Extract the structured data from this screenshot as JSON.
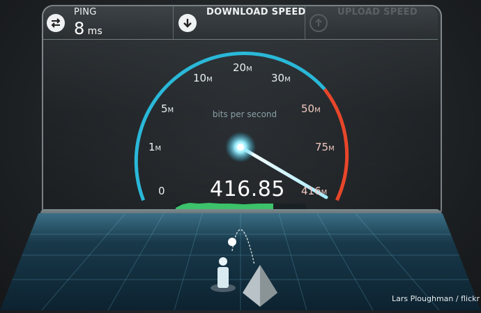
{
  "header": {
    "ping_label": "PING",
    "ping_value": "8",
    "ping_unit": "ms",
    "download_label": "DOWNLOAD SPEED",
    "upload_label": "UPLOAD SPEED"
  },
  "gauge": {
    "unit_caption": "bits per second",
    "speed_value": "416.85",
    "ticks": [
      {
        "label": "0",
        "unit": ""
      },
      {
        "label": "1",
        "unit": "M"
      },
      {
        "label": "5",
        "unit": "M"
      },
      {
        "label": "10",
        "unit": "M"
      },
      {
        "label": "20",
        "unit": "M"
      },
      {
        "label": "30",
        "unit": "M"
      },
      {
        "label": "50",
        "unit": "M"
      },
      {
        "label": "75",
        "unit": "M"
      },
      {
        "label": "416",
        "unit": "M"
      }
    ],
    "accent_color": "#2ab8d8",
    "danger_color": "#e8462a",
    "graph_color": "#3cc26a"
  },
  "credit": "Lars Ploughman / flickr"
}
